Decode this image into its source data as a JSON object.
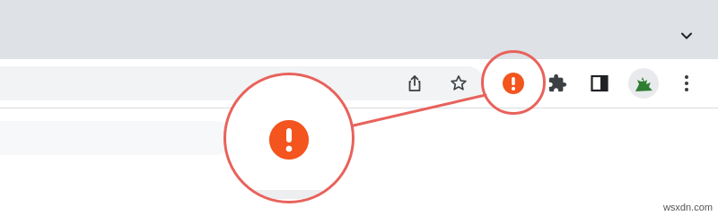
{
  "colors": {
    "tabstrip_bg": "#dee1e6",
    "toolbar_bg": "#ffffff",
    "omnibox_bg": "#f1f3f4",
    "icon_color": "#3c4043",
    "alert_orange": "#f4541e",
    "callout_red": "#e8625b"
  },
  "icons": {
    "tab_search": "chevron-down-icon",
    "share": "share-icon",
    "bookmark": "star-icon",
    "extension_alert": "exclamation-alert-icon",
    "extensions": "puzzle-piece-icon",
    "side_panel": "side-panel-icon",
    "profile": "dinosaur-avatar-icon",
    "menu": "three-dot-menu-icon"
  },
  "watermark": {
    "text": "wsxdn.com"
  }
}
